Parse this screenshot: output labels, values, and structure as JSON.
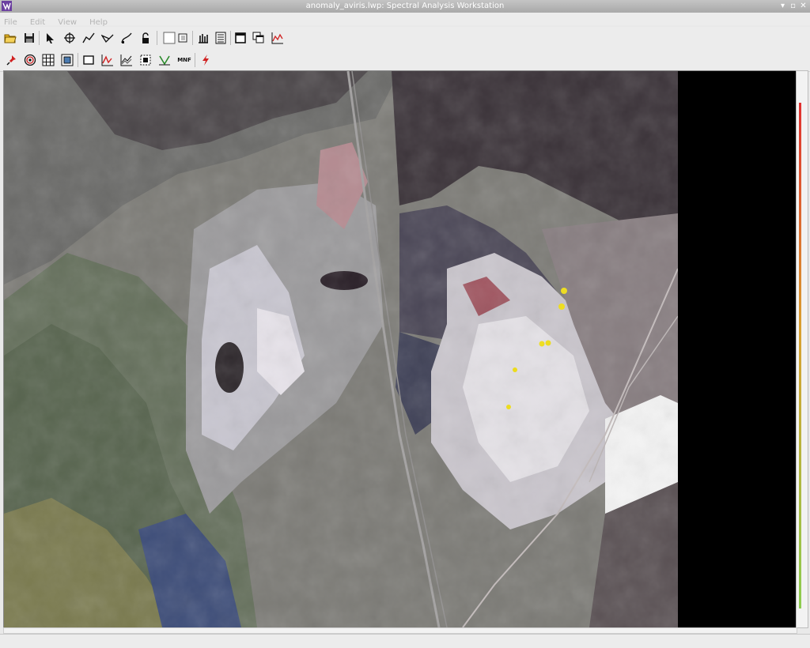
{
  "window": {
    "title": "anomaly_aviris.lwp: Spectral Analysis Workstation",
    "controls": [
      "▾",
      "▫",
      "✕"
    ]
  },
  "menubar": {
    "items": [
      "File",
      "Edit",
      "View",
      "Help"
    ]
  },
  "toolbar_row1": {
    "buttons": [
      "open-folder-icon",
      "save-icon",
      "select-arrow-icon",
      "crosshair-icon",
      "polyline-icon",
      "polygon-icon",
      "freehand-icon",
      "unlock-icon",
      "blank-panel-icon",
      "copy-panel-icon",
      "bar-chart-icon",
      "list-view-icon",
      "window-icon",
      "cascade-windows-icon",
      "spectrum-plot-icon"
    ]
  },
  "toolbar_row2": {
    "buttons": [
      "push-pin-icon",
      "target-icon",
      "grid-icon",
      "roi-image-icon",
      "rectangle-icon",
      "spectral-chart-icon",
      "multi-line-chart-icon",
      "dashed-box-icon",
      "threshold-icon",
      "lightning-icon"
    ],
    "mnf_label": "MNF"
  },
  "status": {
    "text": ""
  },
  "colors": {
    "accent": "#6b3fa0",
    "menu_disabled": "#b4b4b4"
  }
}
